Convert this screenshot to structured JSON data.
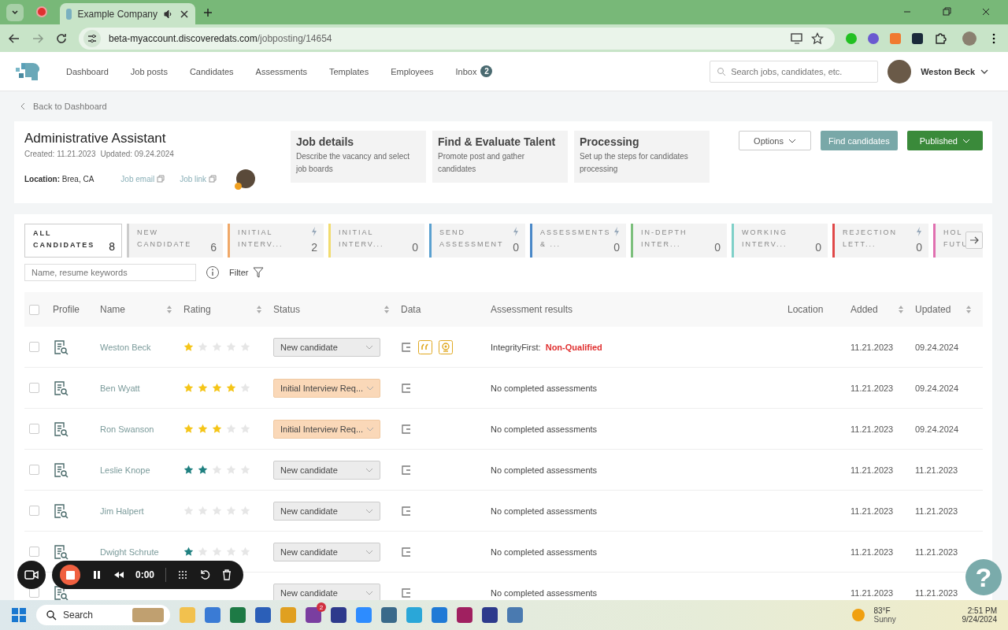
{
  "browser": {
    "tab_title": "Example Company",
    "url_domain": "beta-myaccount.discoveredats.com",
    "url_path": "/jobposting/14654"
  },
  "nav": {
    "items": [
      {
        "label": "Dashboard"
      },
      {
        "label": "Job posts"
      },
      {
        "label": "Candidates"
      },
      {
        "label": "Assessments"
      },
      {
        "label": "Templates"
      },
      {
        "label": "Employees"
      },
      {
        "label": "Inbox",
        "badge": "2"
      }
    ],
    "search_placeholder": "Search jobs, candidates, etc.",
    "user": "Weston Beck"
  },
  "back_link": "Back to Dashboard",
  "job": {
    "title": "Administrative Assistant",
    "created": "Created: 11.21.2023",
    "updated": "Updated: 09.24.2024",
    "location_label": "Location:",
    "location": "Brea, CA",
    "job_email": "Job email",
    "job_link": "Job link"
  },
  "steps": [
    {
      "title": "Job details",
      "description": "Describe the vacancy and select job boards"
    },
    {
      "title": "Find & Evaluate Talent",
      "description": "Promote post and gather candidates"
    },
    {
      "title": "Processing",
      "description": "Set up the steps for candidates processing"
    }
  ],
  "buttons": {
    "options": "Options",
    "find": "Find candidates",
    "published": "Published"
  },
  "pipeline": [
    {
      "line1": "ALL",
      "line2": "CANDIDATES",
      "count": "8",
      "selected": true,
      "automated": false
    },
    {
      "line1": "NEW",
      "line2": "CANDIDATE",
      "count": "6",
      "selected": false,
      "automated": false,
      "color": "#cccccc"
    },
    {
      "line1": "INITIAL",
      "line2": "INTERV...",
      "count": "2",
      "selected": false,
      "automated": true,
      "color": "#f0a868"
    },
    {
      "line1": "INITIAL",
      "line2": "INTERV...",
      "count": "0",
      "selected": false,
      "automated": false,
      "color": "#f2dc6e"
    },
    {
      "line1": "SEND",
      "line2": "ASSESSMENT",
      "count": "0",
      "selected": false,
      "automated": true,
      "color": "#5aa0d0"
    },
    {
      "line1": "ASSESSMENTS",
      "line2": "& ...",
      "count": "0",
      "selected": false,
      "automated": true,
      "color": "#4a88c8"
    },
    {
      "line1": "IN-DEPTH",
      "line2": "INTER...",
      "count": "0",
      "selected": false,
      "automated": false,
      "color": "#7cbf7c"
    },
    {
      "line1": "WORKING",
      "line2": "INTERV...",
      "count": "0",
      "selected": false,
      "automated": false,
      "color": "#7fd0c8"
    },
    {
      "line1": "REJECTION",
      "line2": "LETT...",
      "count": "0",
      "selected": false,
      "automated": true,
      "color": "#e04848"
    },
    {
      "line1": "HOL",
      "line2": "FUTU",
      "selected": false,
      "color": "#e070b0"
    }
  ],
  "filter": {
    "placeholder": "Name, resume keywords",
    "label": "Filter"
  },
  "table": {
    "select_all_checked": false,
    "columns": [
      {
        "label": "Profile",
        "sortable": false
      },
      {
        "label": "Name",
        "sortable": true
      },
      {
        "label": "Rating",
        "sortable": true
      },
      {
        "label": "Status",
        "sortable": true
      },
      {
        "label": "Data",
        "sortable": false
      },
      {
        "label": "Assessment results",
        "sortable": false
      },
      {
        "label": "Location",
        "sortable": false
      },
      {
        "label": "Added",
        "sortable": true
      },
      {
        "label": "Updated",
        "sortable": true
      }
    ],
    "rows": [
      {
        "checked": false,
        "name": "Weston Beck",
        "stars": 1,
        "color": "#f5c518",
        "status": {
          "label": "New candidate",
          "kind": "new"
        },
        "data": [
          {
            "kind": "note"
          },
          {
            "kind": "quote"
          },
          {
            "kind": "badge"
          }
        ],
        "assessment": {
          "kind": "result",
          "test": "IntegrityFirst:",
          "result": "Non-Qualified"
        },
        "added": "11.21.2023",
        "updated": "09.24.2024"
      },
      {
        "checked": false,
        "name": "Ben Wyatt",
        "stars": 4,
        "color": "#f5c518",
        "status": {
          "label": "Initial Interview Req...",
          "kind": "interview"
        },
        "data": [
          {
            "kind": "note"
          }
        ],
        "assessment": {
          "kind": "none",
          "text": "No completed assessments"
        },
        "added": "11.21.2023",
        "updated": "09.24.2024"
      },
      {
        "checked": false,
        "name": "Ron Swanson",
        "stars": 3,
        "color": "#f5c518",
        "status": {
          "label": "Initial Interview Req...",
          "kind": "interview"
        },
        "data": [
          {
            "kind": "note"
          }
        ],
        "assessment": {
          "kind": "none",
          "text": "No completed assessments"
        },
        "added": "11.21.2023",
        "updated": "09.24.2024"
      },
      {
        "checked": false,
        "name": "Leslie Knope",
        "stars": 2,
        "color": "#1f8080",
        "status": {
          "label": "New candidate",
          "kind": "new"
        },
        "data": [
          {
            "kind": "note"
          }
        ],
        "assessment": {
          "kind": "none",
          "text": "No completed assessments"
        },
        "added": "11.21.2023",
        "updated": "11.21.2023"
      },
      {
        "checked": false,
        "name": "Jim Halpert",
        "stars": 0,
        "status": {
          "label": "New candidate",
          "kind": "new"
        },
        "data": [
          {
            "kind": "note"
          }
        ],
        "assessment": {
          "kind": "none",
          "text": "No completed assessments"
        },
        "added": "11.21.2023",
        "updated": "11.21.2023"
      },
      {
        "checked": false,
        "name": "Dwight Schrute",
        "stars": 1,
        "color": "#1f8080",
        "status": {
          "label": "New candidate",
          "kind": "new"
        },
        "data": [
          {
            "kind": "note"
          }
        ],
        "assessment": {
          "kind": "none",
          "text": "No completed assessments"
        },
        "added": "11.21.2023",
        "updated": "11.21.2023"
      },
      {
        "checked": false,
        "status": {
          "label": "New candidate",
          "kind": "new"
        },
        "data": [
          {
            "kind": "note"
          }
        ],
        "assessment": {
          "kind": "none",
          "text": "No completed assessments"
        },
        "added": "11.21.2023",
        "updated": "11.21.2023"
      }
    ]
  },
  "recorder": {
    "time": "0:00"
  },
  "help": "?",
  "taskbar": {
    "search": "Search",
    "chat_badge": "2",
    "temperature": "83°F",
    "weather": "Sunny",
    "time": "2:51 PM",
    "date": "9/24/2024"
  }
}
